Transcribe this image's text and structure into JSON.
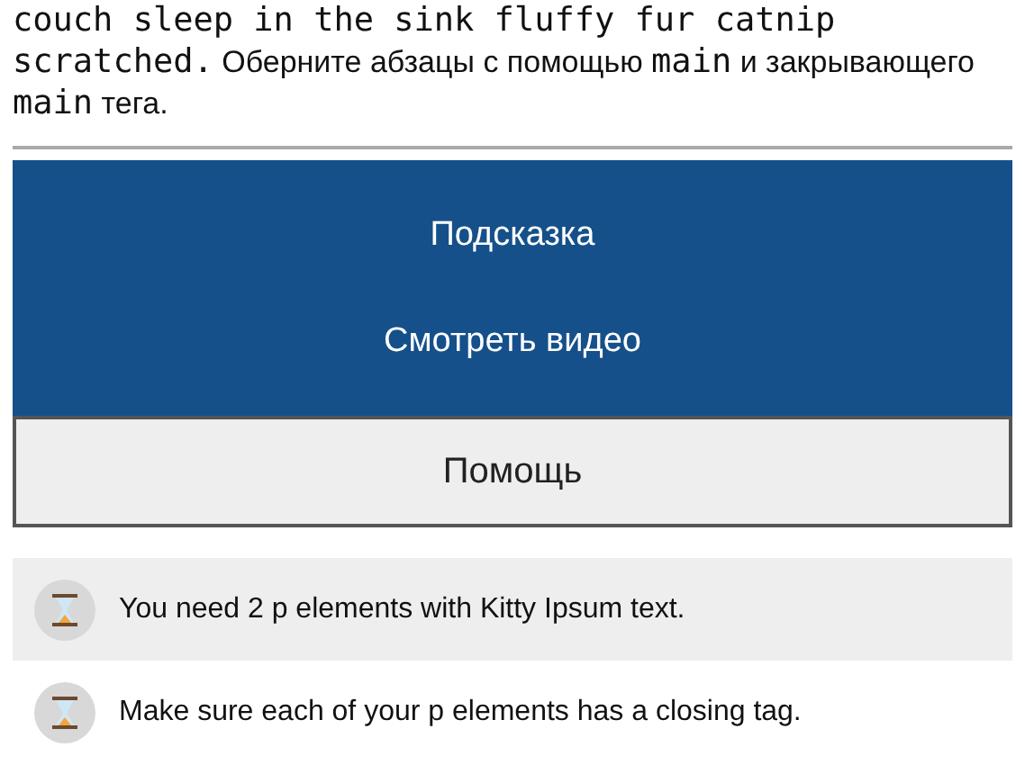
{
  "description": [
    {
      "kind": "code",
      "text": "couch sleep in the sink fluffy fur catnip scratched."
    },
    {
      "kind": "text",
      "text": " Оберните абзацы с помощью "
    },
    {
      "kind": "code",
      "text": "main"
    },
    {
      "kind": "text",
      "text": " и закрывающего "
    },
    {
      "kind": "code",
      "text": "main"
    },
    {
      "kind": "text",
      "text": " тега."
    }
  ],
  "action_buttons": [
    "Подсказка",
    "Смотреть видео"
  ],
  "help_button": "Помощь",
  "tests": [
    {
      "text": "You need 2 p elements with Kitty Ipsum text."
    },
    {
      "text": "Make sure each of your p elements has a closing tag."
    }
  ]
}
